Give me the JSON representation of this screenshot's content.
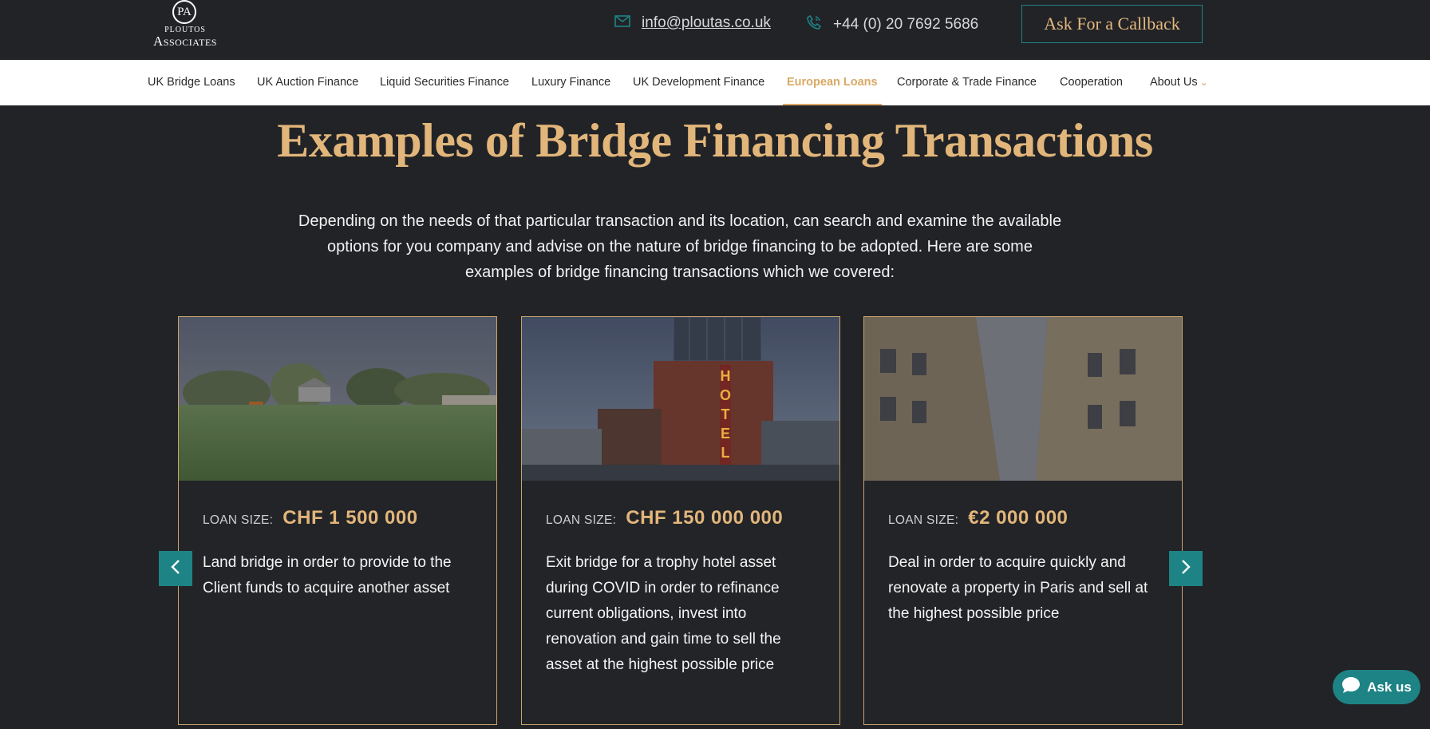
{
  "header": {
    "logo_monogram": "PA",
    "logo_line1": "PLOUTOS",
    "logo_line2": "Associates",
    "email": "info@ploutas.co.uk",
    "phone": "+44 (0) 20 7692 5686",
    "callback_label": "Ask For a Callback"
  },
  "nav": {
    "items": [
      {
        "label": "UK Bridge Loans"
      },
      {
        "label": "UK Auction Finance"
      },
      {
        "label": "Liquid Securities Finance"
      },
      {
        "label": "Luxury Finance"
      },
      {
        "label": "UK Development Finance"
      },
      {
        "label": "European Loans"
      },
      {
        "label": "Corporate & Trade Finance"
      },
      {
        "label": "Cooperation"
      },
      {
        "label": "About Us"
      }
    ],
    "active": "European Loans"
  },
  "main": {
    "title": "Examples of Bridge Financing Transactions",
    "intro": "Depending on the needs of that particular transaction and its location, can search and examine the available options for you company and advise on the nature of bridge financing to be adopted. Here are some examples of bridge financing transactions which we covered:"
  },
  "cards": [
    {
      "loan_label": "LOAN SIZE:",
      "loan_value": "CHF 1 500 000",
      "description": "Land bridge in order to provide to the Client funds to acquire another asset",
      "image": "field-landscape"
    },
    {
      "loan_label": "LOAN SIZE:",
      "loan_value": "CHF 150 000 000",
      "description": "Exit bridge for a trophy hotel asset during COVID in order to refinance current obligations, invest into renovation and gain time to sell the asset at the highest possible price",
      "image": "hotel-building",
      "image_sign": "HOTEL"
    },
    {
      "loan_label": "LOAN SIZE:",
      "loan_value": "€2 000 000",
      "description": "Deal in order to acquire quickly and renovate a property in Paris and sell at the highest possible price",
      "image": "paris-street"
    }
  ],
  "chat": {
    "label": "Ask us"
  },
  "colors": {
    "background": "#222327",
    "gold": "#e2b67a",
    "teal": "#1e8385",
    "nav_bg": "#ffffff"
  },
  "icons": [
    "envelope-icon",
    "phone-icon",
    "chevron-down-icon",
    "chevron-left-icon",
    "chevron-right-icon",
    "chat-bubble-icon"
  ]
}
